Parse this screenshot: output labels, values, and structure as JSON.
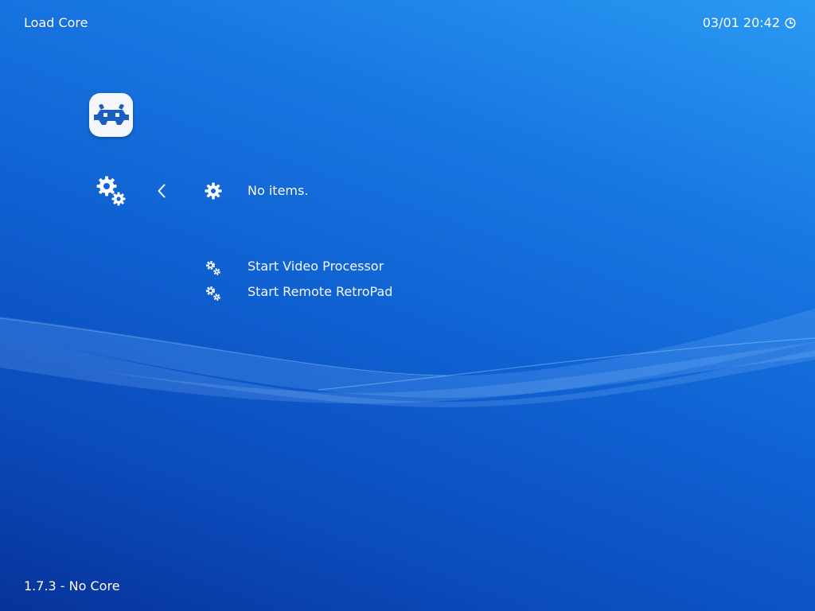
{
  "header": {
    "title": "Load Core",
    "datetime": "03/01 20:42",
    "clock_icon": "clock-icon"
  },
  "logo": {
    "icon": "retroarch-invader-icon"
  },
  "sidebar": {
    "category_icon": "settings-gears-icon",
    "back_icon": "chevron-left-icon"
  },
  "menu": {
    "current_icon": "gear-icon",
    "current_label": "No items.",
    "items": [
      {
        "label": "Start Video Processor",
        "icon": "gears-icon"
      },
      {
        "label": "Start Remote RetroPad",
        "icon": "gears-icon"
      }
    ]
  },
  "footer": {
    "version": "1.7.3 - No Core"
  },
  "theme": {
    "background_top": "#2a9af2",
    "background_bottom": "#07339a",
    "logo_background": "#f4f6fa",
    "logo_color": "#1a5fc0",
    "text_color": "#ffffff"
  }
}
